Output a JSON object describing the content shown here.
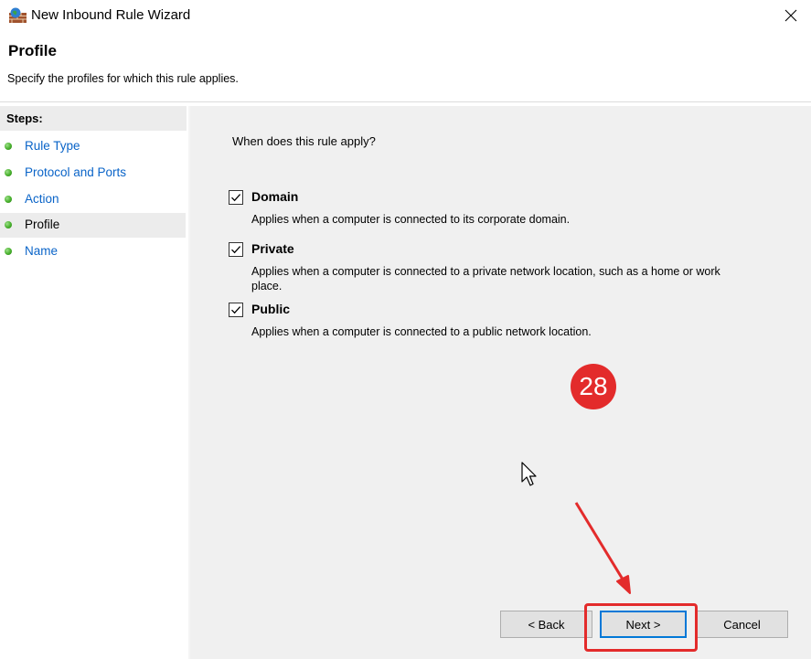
{
  "window": {
    "title": "New Inbound Rule Wizard",
    "icon": "firewall-icon",
    "close_icon": "close-icon"
  },
  "header": {
    "title": "Profile",
    "subtitle": "Specify the profiles for which this rule applies."
  },
  "sidebar": {
    "heading": "Steps:",
    "items": [
      {
        "label": "Rule Type",
        "current": false
      },
      {
        "label": "Protocol and Ports",
        "current": false
      },
      {
        "label": "Action",
        "current": false
      },
      {
        "label": "Profile",
        "current": true
      },
      {
        "label": "Name",
        "current": false
      }
    ]
  },
  "main": {
    "question": "When does this rule apply?",
    "options": [
      {
        "label": "Domain",
        "checked": true,
        "description": "Applies when a computer is connected to its corporate domain."
      },
      {
        "label": "Private",
        "checked": true,
        "description": "Applies when a computer is connected to a private network location, such as a home or work place."
      },
      {
        "label": "Public",
        "checked": true,
        "description": "Applies when a computer is connected to a public network location."
      }
    ]
  },
  "buttons": {
    "back": "< Back",
    "next": "Next >",
    "cancel": "Cancel"
  },
  "annotation": {
    "step_number": "28",
    "color": "#e32b2b"
  },
  "colors": {
    "link": "#0a64c8",
    "step_dot": "#47b02c",
    "content_bg": "#f0f0f0",
    "focus": "#0078d7"
  }
}
